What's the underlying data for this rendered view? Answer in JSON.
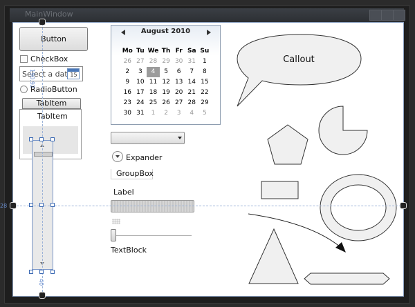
{
  "window": {
    "title": "MainWindow"
  },
  "controls": {
    "button_label": "Button",
    "checkbox_label": "CheckBox",
    "datepicker_placeholder": "Select a date",
    "datepicker_icon_day": "15",
    "radio_label": "RadioButton",
    "tab_header": "TabItem",
    "tab_content": "TabItem",
    "expander_label": "Expander",
    "groupbox_label": "GroupBox",
    "label_text": "Label",
    "textblock_text": "TextBlock",
    "slider_value": 0
  },
  "calendar": {
    "month_label": "August 2010",
    "weekdays": [
      "Mo",
      "Tu",
      "We",
      "Th",
      "Fr",
      "Sa",
      "Su"
    ],
    "days": [
      [
        "26",
        "27",
        "28",
        "29",
        "30",
        "31",
        "1"
      ],
      [
        "2",
        "3",
        "4",
        "5",
        "6",
        "7",
        "8"
      ],
      [
        "9",
        "10",
        "11",
        "12",
        "13",
        "14",
        "15"
      ],
      [
        "16",
        "17",
        "18",
        "19",
        "20",
        "21",
        "22"
      ],
      [
        "23",
        "24",
        "25",
        "26",
        "27",
        "28",
        "29"
      ],
      [
        "30",
        "31",
        "1",
        "2",
        "3",
        "4",
        "5"
      ]
    ],
    "selected_day": "4"
  },
  "shapes": {
    "callout_text": "Callout"
  },
  "annotations": {
    "height_readout": "190.92",
    "bottom_readout": "40",
    "left_readout": "28"
  },
  "icons": [
    "calendar-icon",
    "chevron-down-icon",
    "expander-chevron-icon",
    "arrow-left-icon",
    "arrow-right-icon",
    "scroll-up-icon",
    "scroll-down-icon",
    "close-icon"
  ]
}
